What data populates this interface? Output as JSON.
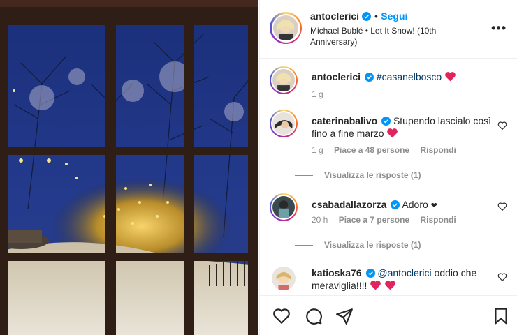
{
  "post": {
    "author": "antoclerici",
    "separator": "•",
    "follow_label": "Segui",
    "audio": "Michael Bublé • Let It Snow! (10th Anniversary)",
    "more_label": "•••"
  },
  "comments": [
    {
      "user": "antoclerici",
      "text_parts": [
        "#casanelbosco"
      ],
      "time": "1 g"
    },
    {
      "user": "caterinabalivo",
      "text": "Stupendo lascialo così fino a fine marzo",
      "time": "1 g",
      "likes": "Piace a 48 persone",
      "reply_label": "Rispondi",
      "view_replies": "Visualizza le risposte (1)"
    },
    {
      "user": "csabadallazorza",
      "text": "Adoro",
      "suffix": "❤",
      "time": "20 h",
      "likes": "Piace a 7 persone",
      "reply_label": "Rispondi",
      "view_replies": "Visualizza le risposte (1)"
    },
    {
      "user": "katioska76",
      "mention": "@antoclerici",
      "text": "oddio che meraviglia!!!!"
    }
  ],
  "icons": [
    "verified-icon",
    "heart-icon",
    "comment-icon",
    "share-icon",
    "bookmark-icon",
    "more-icon"
  ],
  "colors": {
    "accent": "#0095f6",
    "link": "#00376b",
    "heart": "#e0245e",
    "muted": "#8e8e8e"
  }
}
